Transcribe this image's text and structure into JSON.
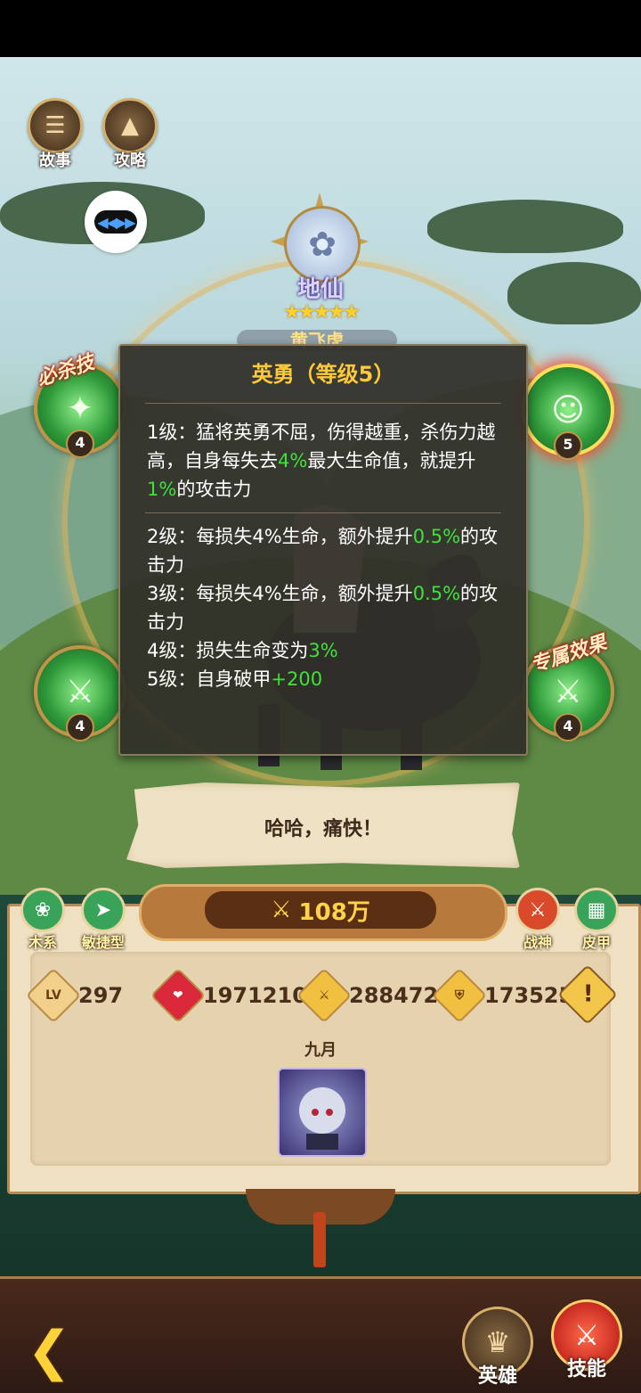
{
  "top_tabs": [
    {
      "label": "故事",
      "icon": "book-icon"
    },
    {
      "label": "攻略",
      "icon": "flame-icon"
    }
  ],
  "hero": {
    "rank": "地仙",
    "stars": "★★★★★",
    "name": "黄飞虎"
  },
  "skills": [
    {
      "id": "skill-top-left",
      "level": "4",
      "tag": "必杀技",
      "icon": "green-slash-icon"
    },
    {
      "id": "skill-top-right",
      "level": "5",
      "tag": "",
      "icon": "warrior-silhouette-icon"
    },
    {
      "id": "skill-bottom-left",
      "level": "4",
      "tag": "",
      "icon": "sword-icon"
    },
    {
      "id": "skill-bottom-right",
      "level": "4",
      "tag": "专属效果",
      "icon": "sword-icon"
    }
  ],
  "tooltip": {
    "title": "英勇（等级5）",
    "level1": {
      "a": "1级：猛将英勇不屈，伤得越重，杀伤力越高，自身每失去",
      "b": "4%",
      "c": "最大生命值，就提升",
      "d": "1%",
      "e": "的攻击力"
    },
    "level2": {
      "a": "2级：每损失4%生命，额外提升",
      "b": "0.5%",
      "c": "的攻击力"
    },
    "level3": {
      "a": "3级：每损失4%生命，额外提升",
      "b": "0.5%",
      "c": "的攻击力"
    },
    "level4": {
      "a": "4级：损失生命变为",
      "b": "3%"
    },
    "level5": {
      "a": "5级：自身破甲",
      "b": "+200"
    }
  },
  "dialog": {
    "text": "哈哈，痛快！"
  },
  "power": {
    "value": "108万"
  },
  "attributes_left": [
    {
      "label": "木系",
      "icon": "wood-element-icon",
      "color": "#3aa35a"
    },
    {
      "label": "敏捷型",
      "icon": "wing-icon",
      "color": "#3aa35a"
    }
  ],
  "attributes_right": [
    {
      "label": "战神",
      "icon": "crossed-swords-icon",
      "color": "#d84a2a"
    },
    {
      "label": "皮甲",
      "icon": "leather-armor-icon",
      "color": "#3aa35a"
    }
  ],
  "stats": {
    "lv_label": "LV",
    "level": "297",
    "hp": "1971210",
    "attack": "288472",
    "defense": "173525"
  },
  "companion": {
    "name": "九月"
  },
  "bottom_nav": [
    {
      "label": "英雄",
      "icon": "hero-icon",
      "active": false
    },
    {
      "label": "技能",
      "icon": "skill-icon",
      "active": true
    }
  ]
}
